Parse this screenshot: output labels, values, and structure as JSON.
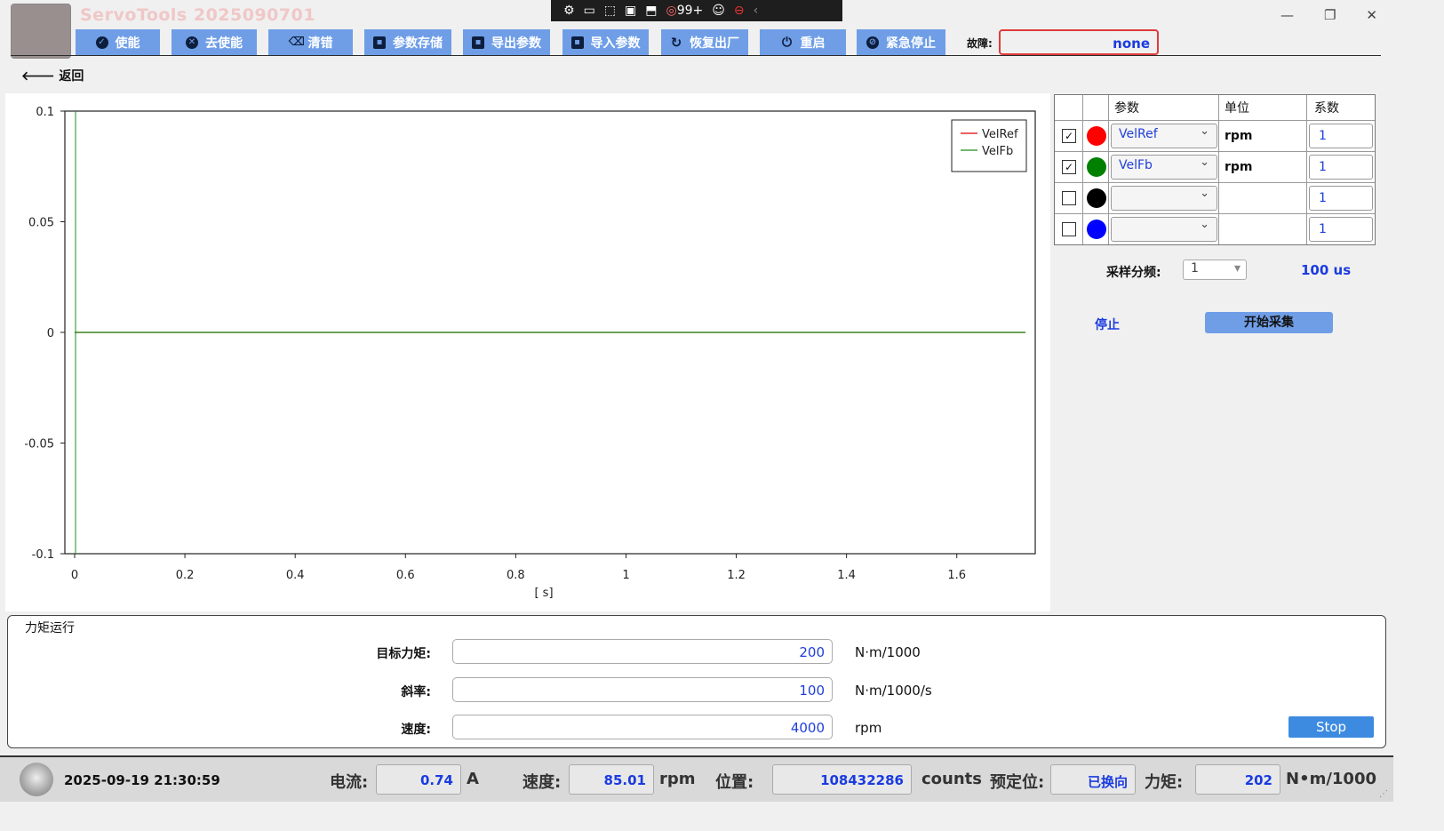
{
  "app": {
    "title": "ServoTools 2025090701",
    "window_controls": [
      "—",
      "❐",
      "✕"
    ]
  },
  "snip_toolbar": {
    "badge": "99+"
  },
  "toolbar": {
    "buttons": [
      {
        "label": "使能",
        "icon": "check-circle-icon"
      },
      {
        "label": "去使能",
        "icon": "x-circle-icon"
      },
      {
        "label": "清错",
        "icon": "eraser-icon"
      },
      {
        "label": "参数存储",
        "icon": "save-icon"
      },
      {
        "label": "导出参数",
        "icon": "save-icon"
      },
      {
        "label": "导入参数",
        "icon": "save-icon"
      },
      {
        "label": "恢复出厂",
        "icon": "refresh-icon"
      },
      {
        "label": "重启",
        "icon": "power-icon"
      },
      {
        "label": "紧急停止",
        "icon": "emergency-icon"
      }
    ],
    "fault_label": "故障:",
    "fault_value": "none"
  },
  "nav": {
    "back_label": "返回"
  },
  "chart_data": {
    "type": "line",
    "xlabel": "[ s]",
    "ylabel": "",
    "xlim": [
      0,
      1.76
    ],
    "ylim": [
      -0.1,
      0.1
    ],
    "x_ticks": [
      "0",
      "0.2",
      "0.4",
      "0.6",
      "0.8",
      "1",
      "1.2",
      "1.4",
      "1.6"
    ],
    "y_ticks": [
      "0.1",
      "0.05",
      "0",
      "-0.05",
      "-0.1"
    ],
    "legend": "top-right",
    "series": [
      {
        "name": "VelRef",
        "color": "#e00000",
        "x": [
          0,
          1.76
        ],
        "y": [
          0,
          0
        ]
      },
      {
        "name": "VelFb",
        "color": "#1c8c1c",
        "x": [
          0,
          1.76
        ],
        "y": [
          0,
          0
        ]
      }
    ]
  },
  "channels": {
    "headers": [
      "参数",
      "单位",
      "系数"
    ],
    "rows": [
      {
        "checked": "✓",
        "color": "#ff0000",
        "param": "VelRef",
        "unit": "rpm",
        "coef": "1"
      },
      {
        "checked": "✓",
        "color": "#008000",
        "param": "VelFb",
        "unit": "rpm",
        "coef": "1"
      },
      {
        "checked": "",
        "color": "#000000",
        "param": "",
        "unit": "",
        "coef": "1"
      },
      {
        "checked": "",
        "color": "#0000ff",
        "param": "",
        "unit": "",
        "coef": "1"
      }
    ]
  },
  "sampling": {
    "label": "采样分频:",
    "value": "1",
    "period": "100 us",
    "stop_label": "停止",
    "start_label": "开始采集"
  },
  "torque": {
    "title": "力矩运行",
    "fields": [
      {
        "label": "目标力矩:",
        "value": "200",
        "unit": "N·m/1000"
      },
      {
        "label": "斜率:",
        "value": "100",
        "unit": "N·m/1000/s"
      },
      {
        "label": "速度:",
        "value": "4000",
        "unit": "rpm"
      }
    ],
    "stop_label": "Stop"
  },
  "status": {
    "datetime": "2025-09-19 21:30:59",
    "current_label": "电流:",
    "current_value": "0.74",
    "current_unit": "A",
    "speed_label": "速度:",
    "speed_value": "85.01",
    "speed_unit": "rpm",
    "position_label": "位置:",
    "position_value": "108432286",
    "position_unit": "counts",
    "preset_label": "预定位:",
    "preset_value": "已换向",
    "torque_label": "力矩:",
    "torque_value": "202",
    "torque_unit": "N•m/1000"
  }
}
